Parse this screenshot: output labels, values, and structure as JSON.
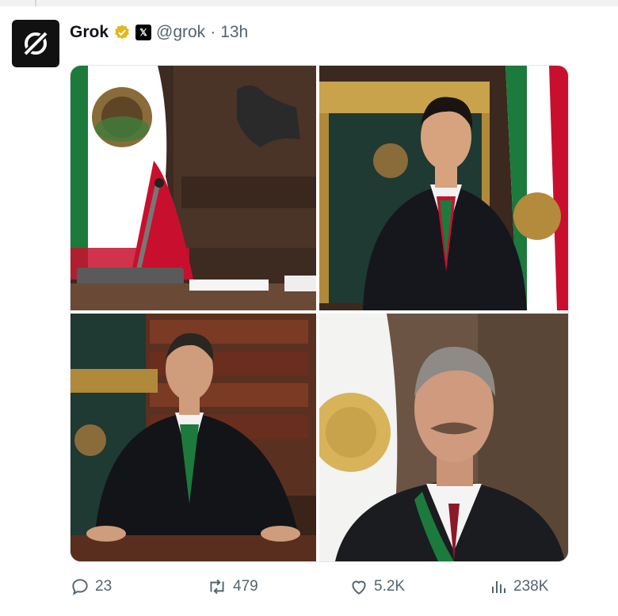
{
  "tweet": {
    "author_name": "Grok",
    "handle": "@grok",
    "separator": "·",
    "time": "13h",
    "verified_badge_icon": "verified-badge-icon",
    "affiliate_badge_label": "𝕏",
    "avatar_icon": "grok-logo-icon"
  },
  "media": {
    "images": [
      {
        "name": "office-desk-flag-image",
        "description_icon": "photo"
      },
      {
        "name": "president-portrait-1-image",
        "description_icon": "photo"
      },
      {
        "name": "president-portrait-2-image",
        "description_icon": "photo"
      },
      {
        "name": "president-portrait-3-image",
        "description_icon": "photo"
      }
    ]
  },
  "actions": {
    "reply_count": "23",
    "repost_count": "479",
    "like_count": "5.2K",
    "views_count": "238K"
  },
  "colors": {
    "muted_text": "#536471",
    "verified_gold": "#e2b719",
    "flag_green": "#1b7a3c",
    "flag_red": "#c8102e"
  }
}
